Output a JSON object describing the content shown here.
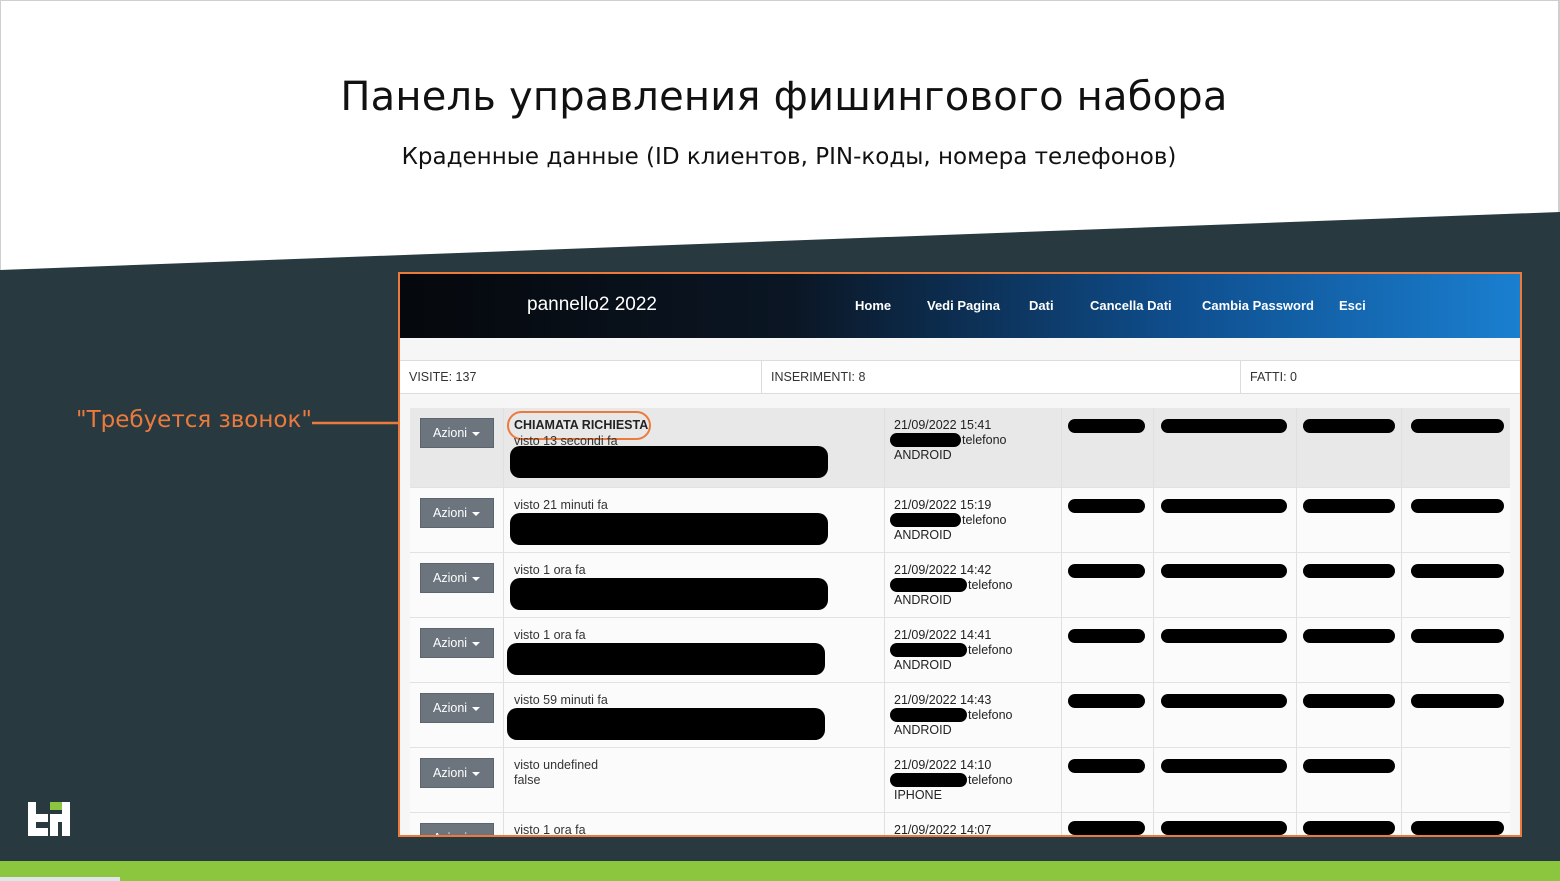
{
  "slide": {
    "title": "Панель управления фишингового набора",
    "subtitle": "Краденные данные (ID клиентов, PIN-коды, номера телефонов)",
    "callout": "\"Требуется звонок\"",
    "colors": {
      "dark_bg": "#283a40",
      "accent_orange": "#ec7a3c",
      "accent_green": "#8cc63e"
    }
  },
  "panel": {
    "brand": "pannello2 2022",
    "nav": [
      "Home",
      "Vedi Pagina",
      "Dati",
      "Cancella Dati",
      "Cambia Password",
      "Esci"
    ],
    "stats": {
      "visite": "VISITE: 137",
      "inserimenti": "INSERIMENTI: 8",
      "fatti": "FATTI: 0"
    },
    "action_label": "Azioni",
    "phone_label": "telefono",
    "rows": [
      {
        "status": "CHIAMATA RICHIESTA",
        "seen": "visto 13 secondi fa",
        "extra": "",
        "date": "21/09/2022 15:41",
        "os": "ANDROID"
      },
      {
        "status": "",
        "seen": "visto 21 minuti fa",
        "extra": "",
        "date": "21/09/2022 15:19",
        "os": "ANDROID"
      },
      {
        "status": "",
        "seen": "visto 1 ora fa",
        "extra": "",
        "date": "21/09/2022 14:42",
        "os": "ANDROID"
      },
      {
        "status": "",
        "seen": "visto 1 ora fa",
        "extra": "",
        "date": "21/09/2022 14:41",
        "os": "ANDROID"
      },
      {
        "status": "",
        "seen": "visto 59 minuti fa",
        "extra": "",
        "date": "21/09/2022 14:43",
        "os": "ANDROID"
      },
      {
        "status": "",
        "seen": "visto undefined",
        "extra": "false",
        "date": "21/09/2022 14:10",
        "os": "IPHONE"
      },
      {
        "status": "",
        "seen": "visto 1 ora fa",
        "extra": "",
        "date": "21/09/2022 14:07",
        "os": ""
      }
    ]
  }
}
